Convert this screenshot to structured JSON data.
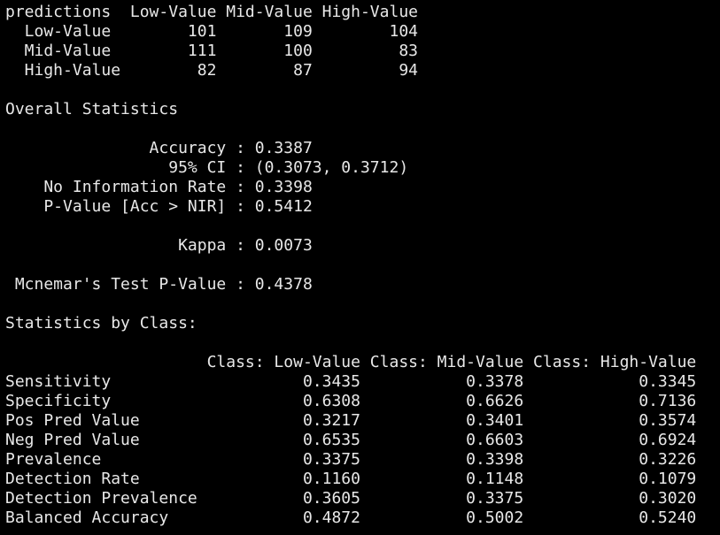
{
  "console": {
    "lines": [
      "predictions  Low-Value Mid-Value High-Value",
      "  Low-Value        101       109        104",
      "  Mid-Value        111       100         83",
      "  High-Value        82        87         94",
      "",
      "Overall Statistics",
      "",
      "               Accuracy : 0.3387",
      "                 95% CI : (0.3073, 0.3712)",
      "    No Information Rate : 0.3398",
      "    P-Value [Acc > NIR] : 0.5412",
      "",
      "                  Kappa : 0.0073",
      "",
      " Mcnemar's Test P-Value : 0.4378",
      "",
      "Statistics by Class:",
      "",
      "                     Class: Low-Value Class: Mid-Value Class: High-Value",
      "Sensitivity                    0.3435           0.3378            0.3345",
      "Specificity                    0.6308           0.6626            0.7136",
      "Pos Pred Value                 0.3217           0.3401            0.3574",
      "Neg Pred Value                 0.6535           0.6603            0.6924",
      "Prevalence                     0.3375           0.3398            0.3226",
      "Detection Rate                 0.1160           0.1148            0.1079",
      "Detection Prevalence           0.3605           0.3375            0.3020",
      "Balanced Accuracy              0.4872           0.5002            0.5240"
    ]
  }
}
